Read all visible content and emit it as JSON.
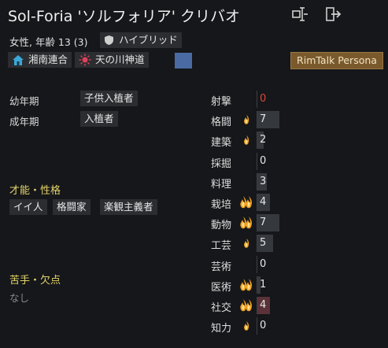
{
  "header": {
    "title": "Sol-Foria 'ソルフォリア' クリバオ",
    "subtitle": "女性, 年齢 13 (3)",
    "xenotype": "ハイブリッド",
    "faction1": "湘南連合",
    "faction2": "天の川神道",
    "faction_color": "#4a6aa3",
    "rimtalk_button": "RimTalk Persona",
    "icons": [
      "rename-icon",
      "banish-icon",
      "shield-icon",
      "faction-house-icon",
      "faction-sun-icon"
    ]
  },
  "backstory": [
    {
      "label": "幼年期",
      "value": "子供入植者"
    },
    {
      "label": "成年期",
      "value": "入植者"
    }
  ],
  "traits": {
    "heading": "才能・性格",
    "items": [
      "イイ人",
      "格闘家",
      "楽観主義者"
    ]
  },
  "incapable": {
    "heading": "苦手・欠点",
    "value": "なし"
  },
  "skills": [
    {
      "name": "射撃",
      "passion": 0,
      "level": "0",
      "fill": 0
    },
    {
      "name": "格闘",
      "passion": 1,
      "level": "7",
      "fill": 7
    },
    {
      "name": "建築",
      "passion": 1,
      "level": "2",
      "fill": 2
    },
    {
      "name": "採掘",
      "passion": 0,
      "level": "0",
      "fill": 0
    },
    {
      "name": "料理",
      "passion": 0,
      "level": "3",
      "fill": 3
    },
    {
      "name": "栽培",
      "passion": 2,
      "level": "4",
      "fill": 4
    },
    {
      "name": "動物",
      "passion": 2,
      "level": "7",
      "fill": 7
    },
    {
      "name": "工芸",
      "passion": 1,
      "level": "5",
      "fill": 5
    },
    {
      "name": "芸術",
      "passion": 0,
      "level": "0",
      "fill": 0
    },
    {
      "name": "医術",
      "passion": 2,
      "level": "1",
      "fill": 1
    },
    {
      "name": "社交",
      "passion": 2,
      "level": "4",
      "fill": 4
    },
    {
      "name": "知力",
      "passion": 1,
      "level": "0",
      "fill": 0
    }
  ],
  "colors": {
    "accent_yellow": "#e6d46a",
    "red_level": "#d9463c",
    "social_bar": "#5a3238"
  }
}
